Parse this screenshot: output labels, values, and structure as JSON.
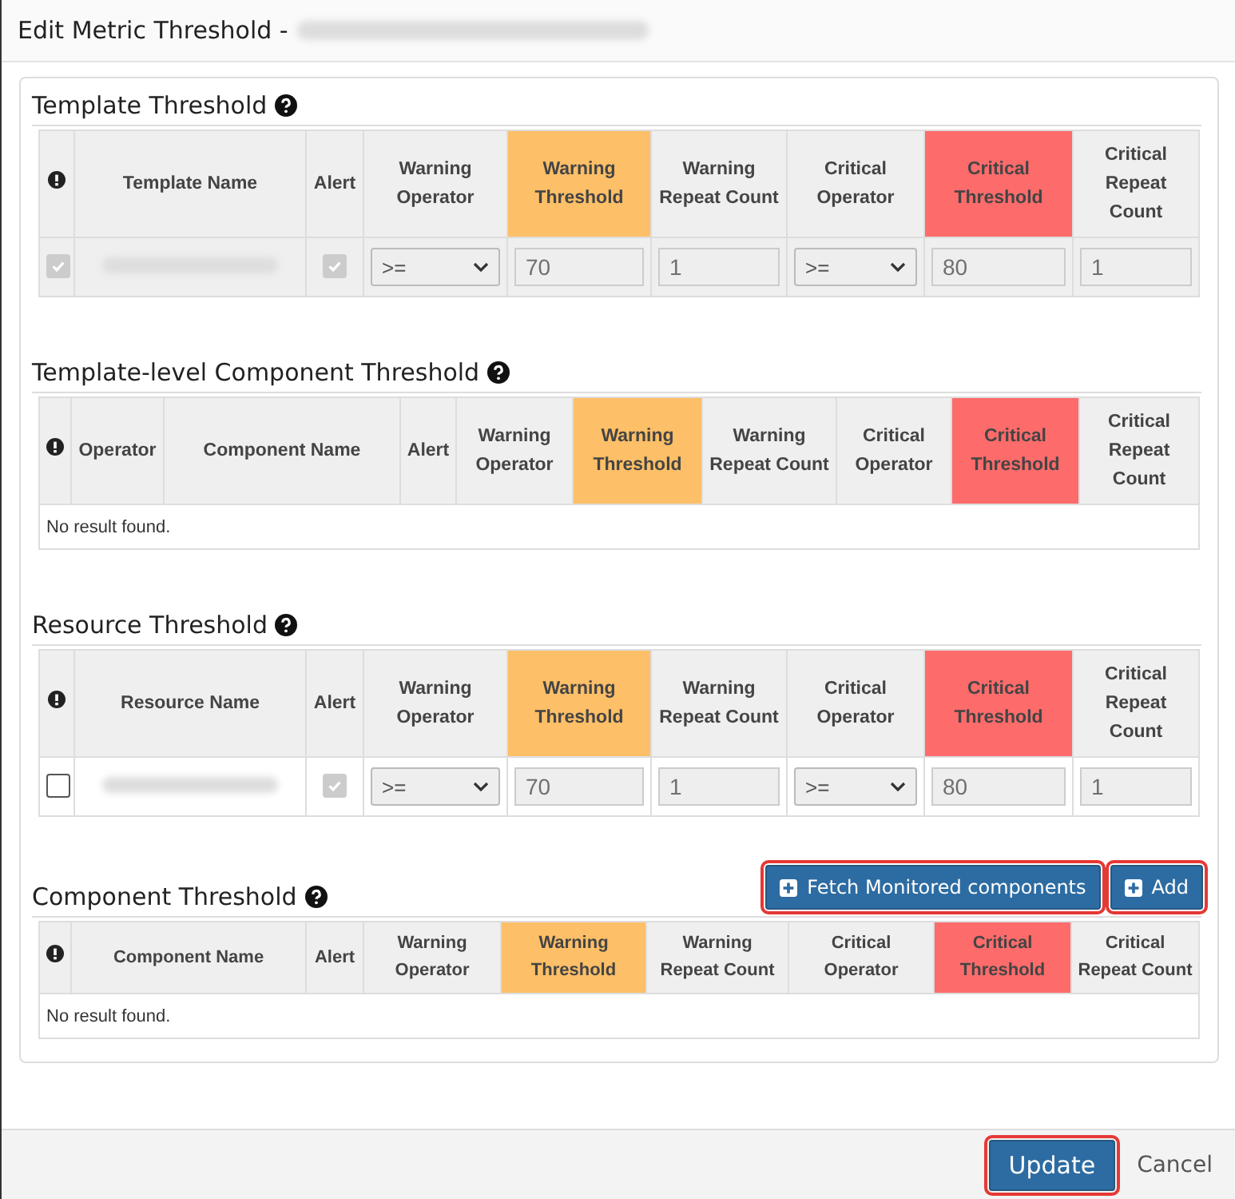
{
  "dialog": {
    "title": "Edit Metric Threshold -"
  },
  "sections": [
    {
      "title": "Template Threshold",
      "columns": [
        {
          "kind": "icon"
        },
        {
          "label": "Template Name",
          "kind": "text"
        },
        {
          "label": "Alert",
          "kind": "text"
        },
        {
          "label": "Warning Operator",
          "kind": "text"
        },
        {
          "label": "Warning Threshold",
          "kind": "text",
          "color": "#fdbf67"
        },
        {
          "label": "Warning Repeat Count",
          "kind": "text"
        },
        {
          "label": "Critical Operator",
          "kind": "text"
        },
        {
          "label": "Critical Threshold",
          "kind": "text",
          "color": "#fd6b6b"
        },
        {
          "label": "Critical Repeat Count",
          "kind": "text"
        }
      ],
      "rows": [
        {
          "cells": [
            {
              "kind": "checkbox",
              "checked": true,
              "disabled": true
            },
            {
              "kind": "hidden"
            },
            {
              "kind": "checkbox",
              "checked": true,
              "disabled": true
            },
            {
              "kind": "select",
              "value": ">=",
              "disabled": true
            },
            {
              "kind": "input",
              "value": "70",
              "disabled": true
            },
            {
              "kind": "input",
              "value": "1",
              "disabled": true
            },
            {
              "kind": "select",
              "value": ">=",
              "disabled": true
            },
            {
              "kind": "input",
              "value": "80",
              "disabled": true
            },
            {
              "kind": "input",
              "value": "1",
              "disabled": true
            }
          ]
        }
      ]
    },
    {
      "title": "Template-level Component Threshold",
      "columns": [
        {
          "kind": "icon"
        },
        {
          "label": "Operator",
          "kind": "text"
        },
        {
          "label": "Component Name",
          "kind": "text"
        },
        {
          "label": "Alert",
          "kind": "text"
        },
        {
          "label": "Warning Operator",
          "kind": "text"
        },
        {
          "label": "Warning Threshold",
          "kind": "text",
          "color": "#fdbf67"
        },
        {
          "label": "Warning Repeat Count",
          "kind": "text"
        },
        {
          "label": "Critical Operator",
          "kind": "text"
        },
        {
          "label": "Critical Threshold",
          "kind": "text",
          "color": "#fd6b6b"
        },
        {
          "label": "Critical Repeat Count",
          "kind": "text"
        }
      ],
      "empty_text": "No result found."
    },
    {
      "title": "Resource Threshold",
      "columns": [
        {
          "kind": "icon"
        },
        {
          "label": "Resource Name",
          "kind": "text"
        },
        {
          "label": "Alert",
          "kind": "text"
        },
        {
          "label": "Warning Operator",
          "kind": "text"
        },
        {
          "label": "Warning Threshold",
          "kind": "text",
          "color": "#fdbf67"
        },
        {
          "label": "Warning Repeat Count",
          "kind": "text"
        },
        {
          "label": "Critical Operator",
          "kind": "text"
        },
        {
          "label": "Critical Threshold",
          "kind": "text",
          "color": "#fd6b6b"
        },
        {
          "label": "Critical Repeat Count",
          "kind": "text"
        }
      ],
      "rows": [
        {
          "cells": [
            {
              "kind": "checkbox",
              "checked": false,
              "disabled": false
            },
            {
              "kind": "hidden"
            },
            {
              "kind": "checkbox",
              "checked": true,
              "disabled": true
            },
            {
              "kind": "select",
              "value": ">=",
              "disabled": true
            },
            {
              "kind": "input",
              "value": "70",
              "disabled": true
            },
            {
              "kind": "input",
              "value": "1",
              "disabled": true
            },
            {
              "kind": "select",
              "value": ">=",
              "disabled": true
            },
            {
              "kind": "input",
              "value": "80",
              "disabled": true
            },
            {
              "kind": "input",
              "value": "1",
              "disabled": true
            }
          ]
        }
      ]
    },
    {
      "title": "Component Threshold",
      "buttons": [
        {
          "label": "Fetch Monitored components",
          "highlighted": true
        },
        {
          "label": "Add",
          "highlighted": true
        }
      ],
      "columns": [
        {
          "kind": "icon"
        },
        {
          "label": "Component Name",
          "kind": "text"
        },
        {
          "label": "Alert",
          "kind": "text"
        },
        {
          "label": "Warning Operator",
          "kind": "text"
        },
        {
          "label": "Warning Threshold",
          "kind": "text",
          "color": "#fdbf67"
        },
        {
          "label": "Warning Repeat Count",
          "kind": "text"
        },
        {
          "label": "Critical Operator",
          "kind": "text"
        },
        {
          "label": "Critical Threshold",
          "kind": "text",
          "color": "#fd6b6b"
        },
        {
          "label": "Critical Repeat Count",
          "kind": "text"
        }
      ],
      "empty_text": "No result found."
    }
  ],
  "footer": {
    "buttons": [
      {
        "label": "Update",
        "kind": "primary",
        "highlighted": true
      },
      {
        "label": "Cancel",
        "kind": "link",
        "highlighted": false
      }
    ]
  }
}
